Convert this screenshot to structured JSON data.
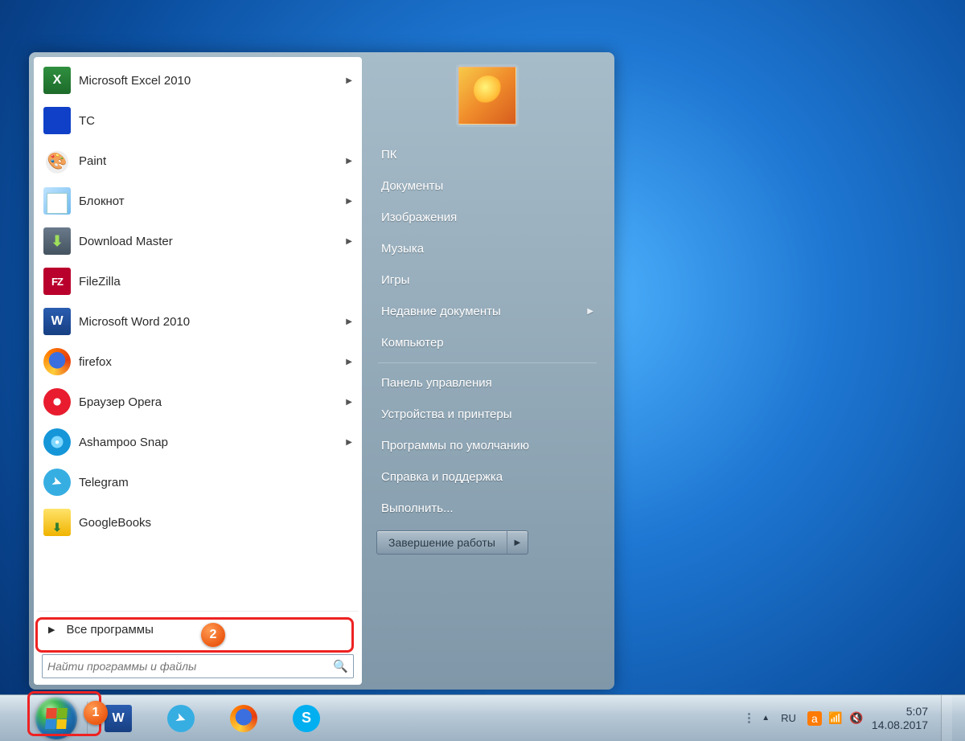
{
  "start_menu": {
    "programs": [
      {
        "label": "Microsoft Excel 2010",
        "icon": "ic-excel",
        "has_submenu": true
      },
      {
        "label": "TC",
        "icon": "ic-tc",
        "has_submenu": false
      },
      {
        "label": "Paint",
        "icon": "ic-paint",
        "has_submenu": true
      },
      {
        "label": "Блокнот",
        "icon": "ic-note",
        "has_submenu": true
      },
      {
        "label": "Download Master",
        "icon": "ic-dm",
        "has_submenu": true
      },
      {
        "label": "FileZilla",
        "icon": "ic-fz",
        "has_submenu": false
      },
      {
        "label": "Microsoft Word 2010",
        "icon": "ic-word",
        "has_submenu": true
      },
      {
        "label": "firefox",
        "icon": "ic-ff",
        "has_submenu": true
      },
      {
        "label": "Браузер Opera",
        "icon": "ic-opera",
        "has_submenu": true
      },
      {
        "label": "Ashampoo Snap",
        "icon": "ic-snap",
        "has_submenu": true
      },
      {
        "label": "Telegram",
        "icon": "ic-tg",
        "has_submenu": false
      },
      {
        "label": "GoogleBooks",
        "icon": "ic-gb",
        "has_submenu": false
      }
    ],
    "all_programs_label": "Все программы",
    "search_placeholder": "Найти программы и файлы",
    "right_links": [
      {
        "label": "ПК"
      },
      {
        "label": "Документы"
      },
      {
        "label": "Изображения"
      },
      {
        "label": "Музыка"
      },
      {
        "label": "Игры"
      },
      {
        "label": "Недавние документы",
        "has_submenu": true
      },
      {
        "label": "Компьютер"
      },
      {
        "sep": true
      },
      {
        "label": "Панель управления"
      },
      {
        "label": "Устройства и принтеры"
      },
      {
        "label": "Программы по умолчанию"
      },
      {
        "label": "Справка и поддержка"
      },
      {
        "label": "Выполнить..."
      }
    ],
    "shutdown_label": "Завершение работы"
  },
  "taskbar": {
    "pinned": [
      {
        "name": "word",
        "icon": "ic-word"
      },
      {
        "name": "telegram",
        "icon": "ic-tg"
      },
      {
        "name": "firefox",
        "icon": "ic-ff"
      },
      {
        "name": "skype",
        "icon": "ic-skype"
      }
    ],
    "lang": "RU",
    "time": "5:07",
    "date": "14.08.2017"
  },
  "annotations": {
    "badge1": "1",
    "badge2": "2"
  }
}
